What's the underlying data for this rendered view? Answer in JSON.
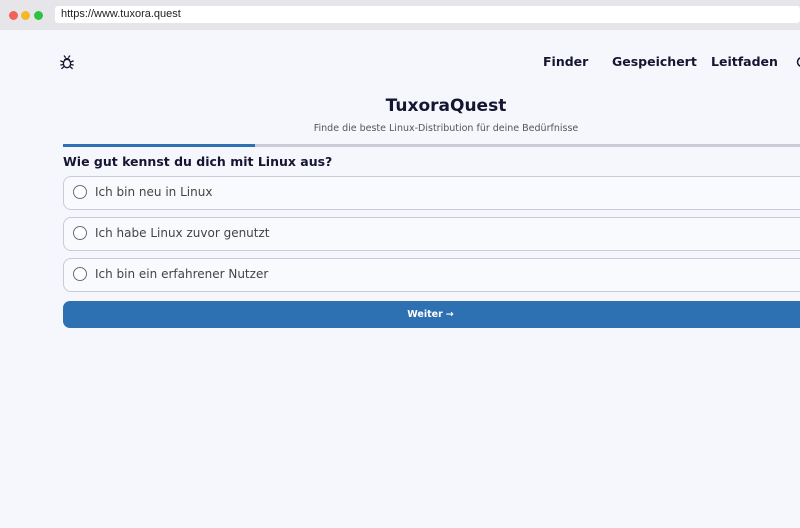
{
  "browser": {
    "url": "https://www.tuxora.quest"
  },
  "nav": {
    "logo_icon": "bug-icon",
    "items": [
      {
        "label": "Finder"
      },
      {
        "label": "Gespeichert"
      },
      {
        "label": "Leitfaden"
      }
    ]
  },
  "header": {
    "title": "TuxoraQuest",
    "subtitle": "Finde die beste Linux-Distribution für deine Bedürfnisse"
  },
  "progress": {
    "fraction": 0.26
  },
  "quiz": {
    "question": "Wie gut kennst du dich mit Linux aus?",
    "options": [
      {
        "label": "Ich bin neu in Linux",
        "selected": false
      },
      {
        "label": "Ich habe Linux zuvor genutzt",
        "selected": false
      },
      {
        "label": "Ich bin ein erfahrener Nutzer",
        "selected": false
      }
    ],
    "next_label": "Weiter",
    "next_icon": "arrow-right-icon"
  },
  "colors": {
    "accent": "#2e71b3",
    "background": "#f5f7fc"
  }
}
